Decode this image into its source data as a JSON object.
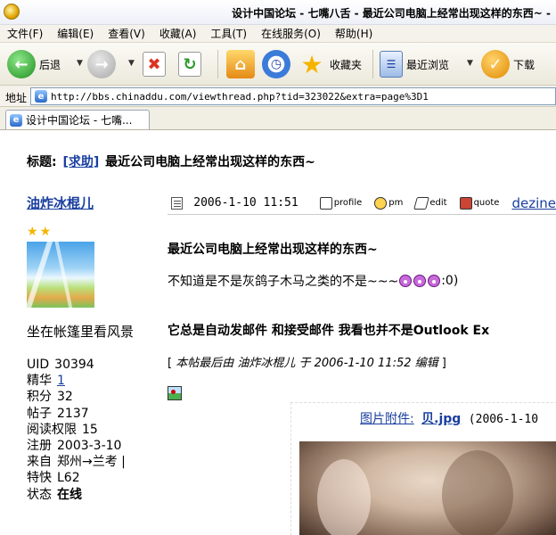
{
  "window": {
    "title": "设计中国论坛 - 七嘴八舌 - 最近公司电脑上经常出现这样的东西~ -"
  },
  "menu": [
    "文件(F)",
    "编辑(E)",
    "查看(V)",
    "收藏(A)",
    "工具(T)",
    "在线服务(O)",
    "帮助(H)"
  ],
  "toolbar": {
    "back": "后退",
    "favorites": "收藏夹",
    "recent": "最近浏览",
    "download": "下载"
  },
  "address": {
    "label": "地址",
    "url": "http://bbs.chinaddu.com/viewthread.php?tid=323022&extra=page%3D1"
  },
  "tab": {
    "label": "设计中国论坛 - 七嘴..."
  },
  "thread": {
    "title_prefix": "标题:",
    "tag": "[求助]",
    "title": "最近公司电脑上经常出现这样的东西~"
  },
  "author": {
    "name": "油炸冰棍儿",
    "user_title": "坐在帐篷里看风景",
    "stats": [
      {
        "key": "UID",
        "value": "30394"
      },
      {
        "key": "精华",
        "value": "1"
      },
      {
        "key": "积分",
        "value": "32"
      },
      {
        "key": "帖子",
        "value": "2137"
      },
      {
        "key": "阅读权限",
        "value": "15"
      },
      {
        "key": "注册",
        "value": "2003-3-10"
      },
      {
        "key": "来自",
        "value": "郑州→兰考 |"
      },
      {
        "key": "特快",
        "value": "L62"
      },
      {
        "key": "状态",
        "value": "在线"
      }
    ]
  },
  "post": {
    "time": "2006-1-10  11:51",
    "actions": {
      "profile": "profile",
      "pm": "pm",
      "edit": "edit",
      "quote": "quote"
    },
    "extra_link": "dezine",
    "subject": "最近公司电脑上经常出现这样的东西~",
    "line1": "不知道是不是灰鸽子木马之类的不是~~~",
    "line1_tail": ":0)",
    "line2": "它总是自动发邮件  和接受邮件    我看也并不是Outlook Ex",
    "edited": "本帖最后由 油炸冰棍儿 于 2006-1-10 11:52 编辑",
    "attachment": {
      "label": "图片附件:",
      "file": "贝.jpg",
      "date": "(2006-1-10"
    }
  },
  "colors": {
    "link": "#1a3f9f",
    "star": "#f2b600"
  }
}
